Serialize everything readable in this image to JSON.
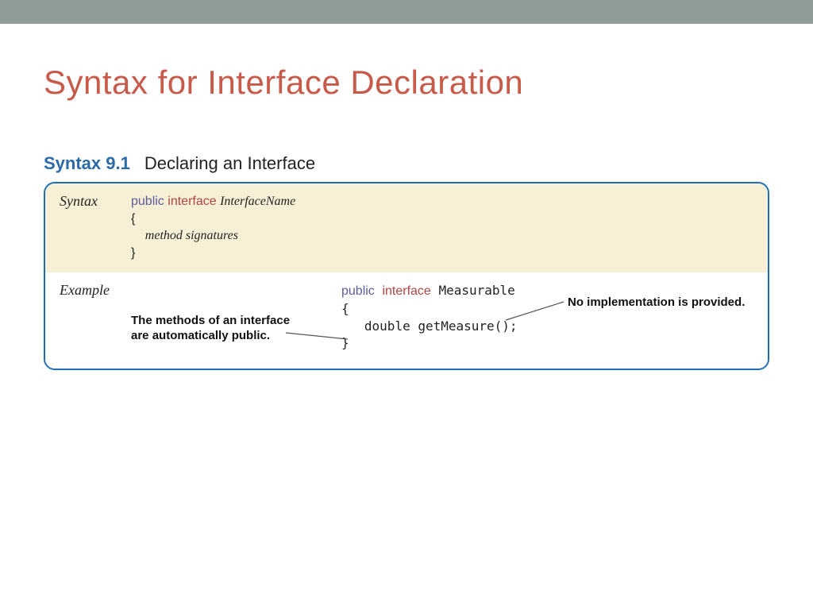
{
  "title": "Syntax for Interface Declaration",
  "syntax_head": {
    "label": "Syntax 9.1",
    "title": "Declaring an Interface"
  },
  "syntax_section": {
    "label": "Syntax",
    "kw_public": "public",
    "kw_interface": "interface",
    "name": "InterfaceName",
    "open": "{",
    "body": "method signatures",
    "close": "}"
  },
  "example_section": {
    "label": "Example",
    "kw_public": "public",
    "kw_interface": "interface",
    "class_name": "Measurable",
    "open": "{",
    "method": "double getMeasure();",
    "close": "}",
    "annot_left": "The methods of an interface are automatically public.",
    "annot_right": "No implementation is provided."
  }
}
